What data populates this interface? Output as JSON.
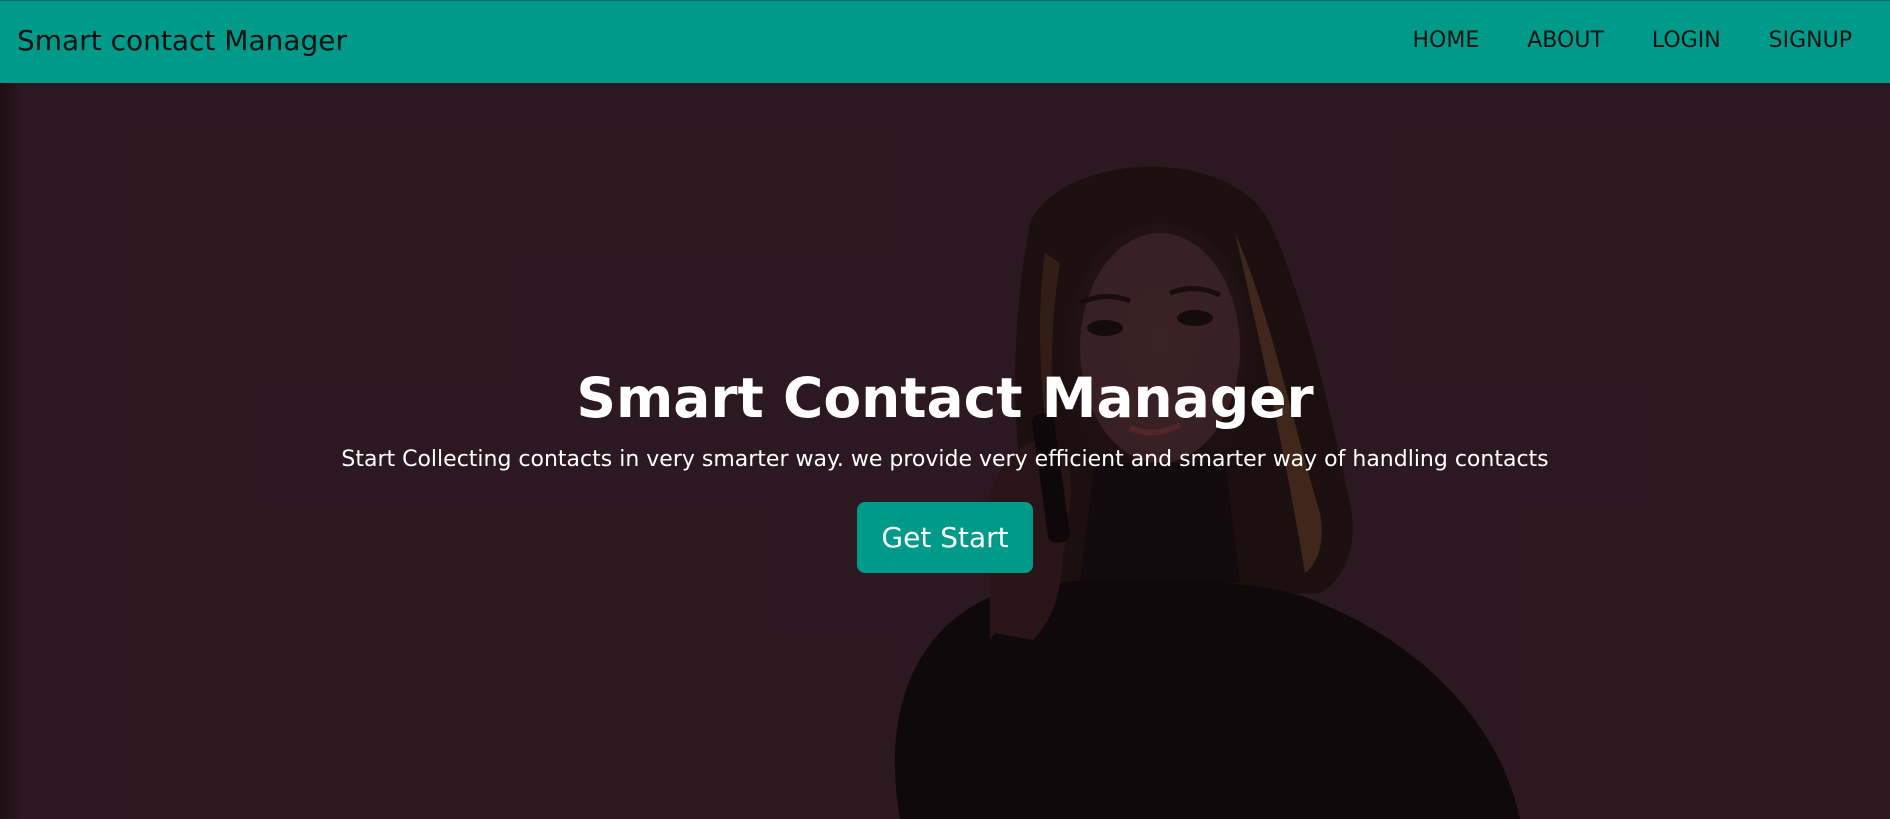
{
  "navbar": {
    "brand": "Smart contact Manager",
    "links": [
      {
        "label": "HOME"
      },
      {
        "label": "ABOUT"
      },
      {
        "label": "LOGIN"
      },
      {
        "label": "SIGNUP"
      }
    ]
  },
  "hero": {
    "title": "Smart Contact Manager",
    "subtitle": "Start Collecting contacts in very smarter way. we provide very efficient and smarter way of handling contacts",
    "cta_label": "Get Start"
  },
  "colors": {
    "navbar_bg": "#009a8b",
    "hero_bg": "#2e1a21",
    "button_bg": "#009a8b",
    "text_light": "#ffffff",
    "text_dark": "#111111"
  }
}
